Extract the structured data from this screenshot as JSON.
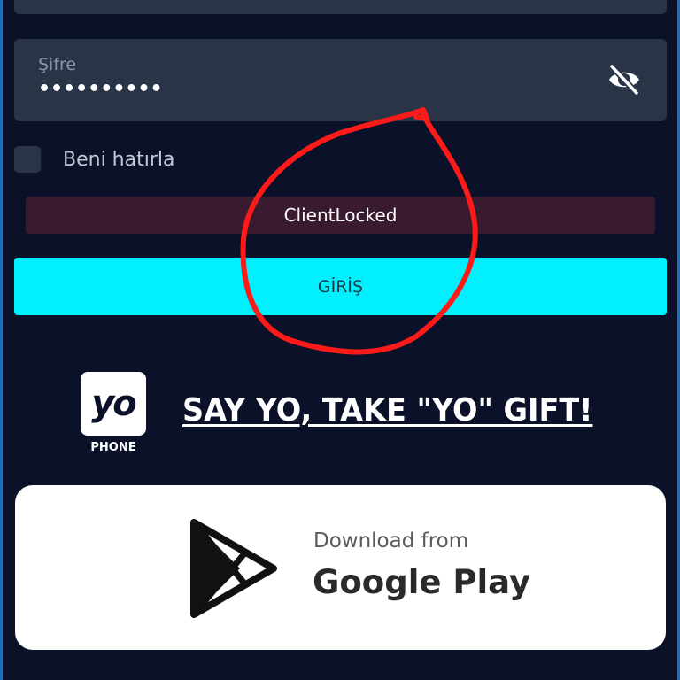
{
  "colors": {
    "background": "#0a1128",
    "field": "#2a3447",
    "accent": "#00f0ff",
    "error_bg": "#3a1a2e",
    "annotation": "#ff1a1a"
  },
  "password": {
    "label": "Şifre",
    "value": "••••••••••",
    "toggle_icon": "eye-off-icon"
  },
  "remember": {
    "label": "Beni hatırla",
    "checked": false
  },
  "error": {
    "message": "ClientLocked"
  },
  "login": {
    "label": "GİRİŞ"
  },
  "promo": {
    "logo_text": "yo",
    "logo_caption": "PHONE",
    "headline": "SAY YO, TAKE \"YO\" GIFT!"
  },
  "store_badge": {
    "icon": "google-play-icon",
    "small_text": "Download from",
    "big_text": "Google Play"
  }
}
